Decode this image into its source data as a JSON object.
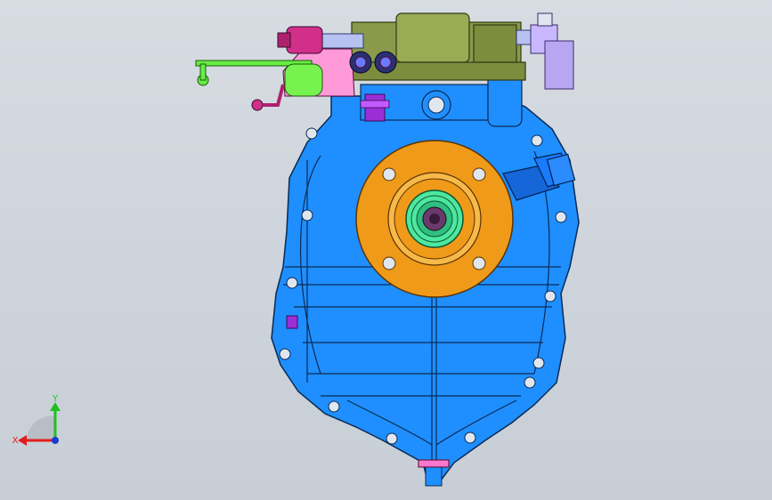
{
  "viewport": {
    "background": "#cfd5dc"
  },
  "model": {
    "housing_color": "#1f8fff",
    "flange_color": "#f09a1a",
    "top_block_color": "#8a9a4a",
    "lever_color": "#66ee44",
    "bracket_color": "#ff77cc",
    "right_bracket_color": "#b9a6f2",
    "fitting_color": "#1466d9"
  },
  "triad": {
    "x_label": "X",
    "y_label": "Y",
    "x_color": "#e01e1e",
    "y_color": "#1fbf1f",
    "z_color": "#1a3ad6",
    "icon": "axis-triad-icon"
  }
}
